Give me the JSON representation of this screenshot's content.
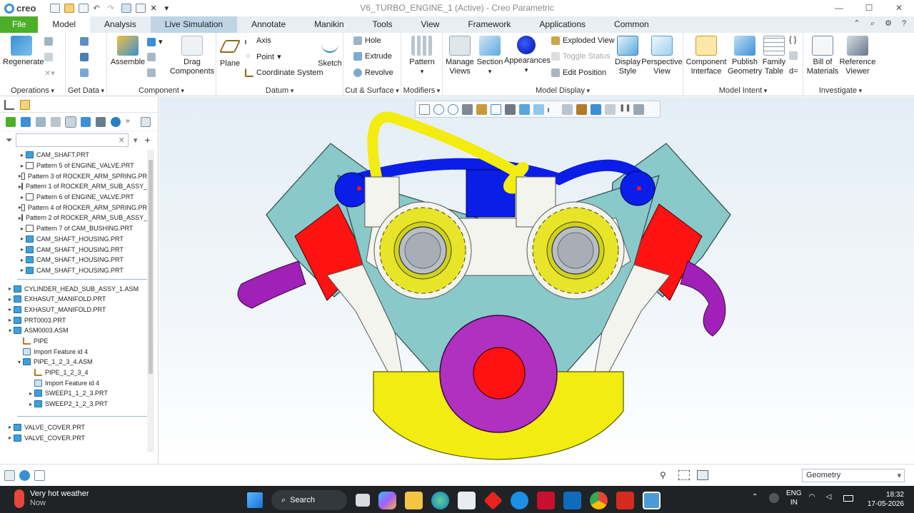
{
  "titlebar": {
    "app_name": "creo",
    "window_title": "V6_TURBO_ENGINE_1 (Active) - Creo Parametric",
    "minimize_icon": "minimize-icon",
    "maximize_icon": "maximize-icon",
    "close_icon": "close-icon"
  },
  "tabs": [
    {
      "label": "File"
    },
    {
      "label": "Model"
    },
    {
      "label": "Analysis"
    },
    {
      "label": "Live Simulation"
    },
    {
      "label": "Annotate"
    },
    {
      "label": "Manikin"
    },
    {
      "label": "Tools"
    },
    {
      "label": "View"
    },
    {
      "label": "Framework"
    },
    {
      "label": "Applications"
    },
    {
      "label": "Common"
    }
  ],
  "ribbon": {
    "operations": {
      "label": "Operations",
      "regenerate": "Regenerate"
    },
    "get_data": {
      "label": "Get Data"
    },
    "component": {
      "label": "Component",
      "assemble": "Assemble",
      "drag": "Drag\nComponents"
    },
    "datum": {
      "label": "Datum",
      "plane": "Plane",
      "axis": "Axis",
      "point": "Point",
      "coord": "Coordinate System",
      "sketch": "Sketch"
    },
    "cut_surface": {
      "label": "Cut & Surface",
      "hole": "Hole",
      "extrude": "Extrude",
      "revolve": "Revolve"
    },
    "modifiers": {
      "label": "Modifiers",
      "pattern": "Pattern"
    },
    "model_display": {
      "label": "Model Display",
      "manage_views": "Manage\nViews",
      "section": "Section",
      "appearances": "Appearances",
      "exploded": "Exploded View",
      "toggle_status": "Toggle Status",
      "edit_position": "Edit Position",
      "display_style": "Display\nStyle",
      "perspective": "Perspective\nView"
    },
    "model_intent": {
      "label": "Model Intent",
      "component_interface": "Component\nInterface",
      "publish_geometry": "Publish\nGeometry",
      "family_table": "Family\nTable"
    },
    "investigate": {
      "label": "Investigate",
      "bom": "Bill of\nMaterials",
      "reference_viewer": "Reference\nViewer"
    }
  },
  "model_tree": {
    "filter_placeholder": "",
    "items": [
      {
        "label": "CAM_SHAFT.PRT",
        "type": "part"
      },
      {
        "label": "Pattern 5 of ENGINE_VALVE.PRT",
        "type": "pattern"
      },
      {
        "label": "Pattern 3 of ROCKER_ARM_SPRING.PR",
        "type": "pattern"
      },
      {
        "label": "Pattern 1 of ROCKER_ARM_SUB_ASSY_",
        "type": "pattern"
      },
      {
        "label": "Pattern 6 of ENGINE_VALVE.PRT",
        "type": "pattern"
      },
      {
        "label": "Pattern 4 of ROCKER_ARM_SPRING.PR",
        "type": "pattern"
      },
      {
        "label": "Pattern 2 of ROCKER_ARM_SUB_ASSY_",
        "type": "pattern"
      },
      {
        "label": "Pattern 7 of CAM_BUSHING.PRT",
        "type": "pattern"
      },
      {
        "label": "CAM_SHAFT_HOUSING.PRT",
        "type": "part"
      },
      {
        "label": "CAM_SHAFT_HOUSING.PRT",
        "type": "part"
      },
      {
        "label": "CAM_SHAFT_HOUSING.PRT",
        "type": "part"
      },
      {
        "label": "CAM_SHAFT_HOUSING.PRT",
        "type": "part"
      },
      {
        "label": "CYLINDER_HEAD_SUB_ASSY_1.ASM",
        "type": "part"
      },
      {
        "label": "EXHASUT_MANIFOLD.PRT",
        "type": "part"
      },
      {
        "label": "EXHASUT_MANIFOLD.PRT",
        "type": "part"
      },
      {
        "label": "PRT0003.PRT",
        "type": "part"
      },
      {
        "label": "ASM0003.ASM",
        "type": "part"
      },
      {
        "label": "PIPE",
        "type": "feat"
      },
      {
        "label": "Import Feature id 4",
        "type": "imp"
      },
      {
        "label": "PIPE_1_2_3_4.ASM",
        "type": "part"
      },
      {
        "label": "PIPE_1_2_3_4",
        "type": "feat"
      },
      {
        "label": "Import Feature id 4",
        "type": "imp"
      },
      {
        "label": "SWEEP1_1_2_3.PRT",
        "type": "part"
      },
      {
        "label": "SWEEP2_1_2_3.PRT",
        "type": "part"
      },
      {
        "label": "VALVE_COVER.PRT",
        "type": "part"
      },
      {
        "label": "VALVE_COVER.PRT",
        "type": "part"
      }
    ]
  },
  "statusbar": {
    "filter_value": "Geometry"
  },
  "taskbar": {
    "weather_title": "Very hot weather",
    "weather_sub": "Now",
    "search_label": "Search",
    "lang_top": "ENG",
    "lang_bottom": "IN",
    "time": "18:32",
    "date": "17-05-2026"
  },
  "colors": {
    "file_tab": "#4caf2a",
    "block_teal": "#88c8c8",
    "manifold_purple": "#a020b8",
    "base_yellow": "#f2ec10",
    "pipe_blue": "#0a1ee8",
    "accent_red": "#ff1010"
  }
}
